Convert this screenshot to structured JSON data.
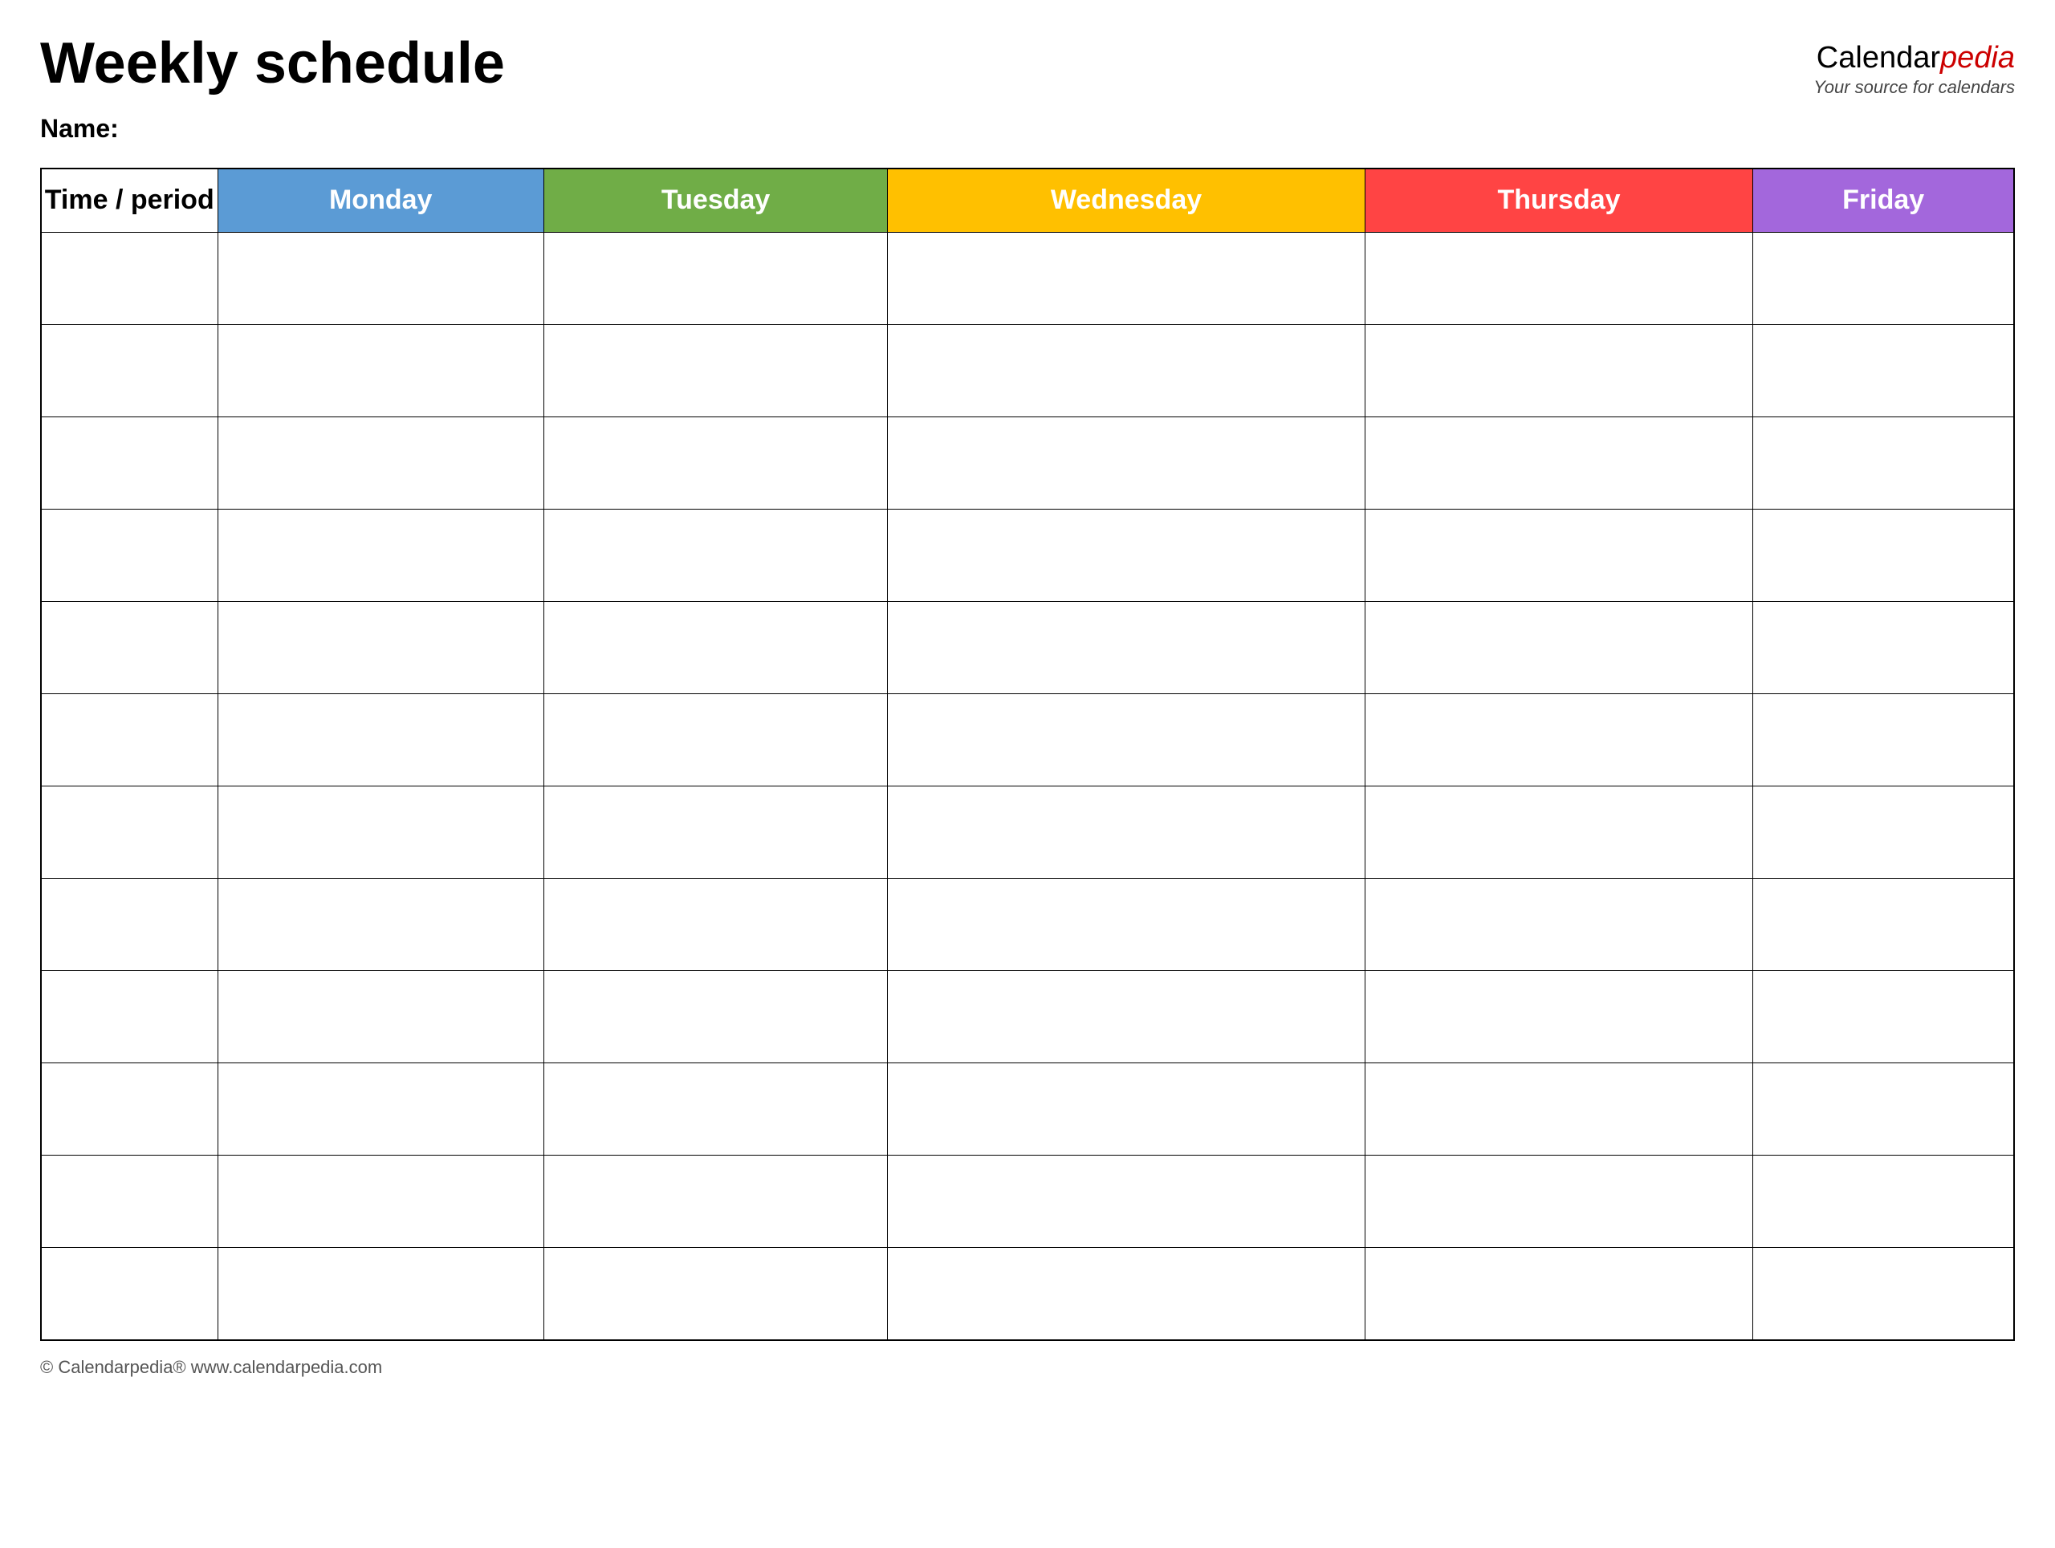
{
  "header": {
    "title": "Weekly schedule",
    "brand": {
      "calendar_part": "Calendar",
      "pedia_part": "pedia",
      "tagline": "Your source for calendars"
    }
  },
  "name_section": {
    "label": "Name:"
  },
  "table": {
    "headers": [
      {
        "id": "time",
        "label": "Time / period",
        "color_class": "th-time"
      },
      {
        "id": "monday",
        "label": "Monday",
        "color_class": "th-monday"
      },
      {
        "id": "tuesday",
        "label": "Tuesday",
        "color_class": "th-tuesday"
      },
      {
        "id": "wednesday",
        "label": "Wednesday",
        "color_class": "th-wednesday"
      },
      {
        "id": "thursday",
        "label": "Thursday",
        "color_class": "th-thursday"
      },
      {
        "id": "friday",
        "label": "Friday",
        "color_class": "th-friday"
      }
    ],
    "row_count": 12
  },
  "footer": {
    "copyright": "© Calendarpedia®  www.calendarpedia.com"
  }
}
